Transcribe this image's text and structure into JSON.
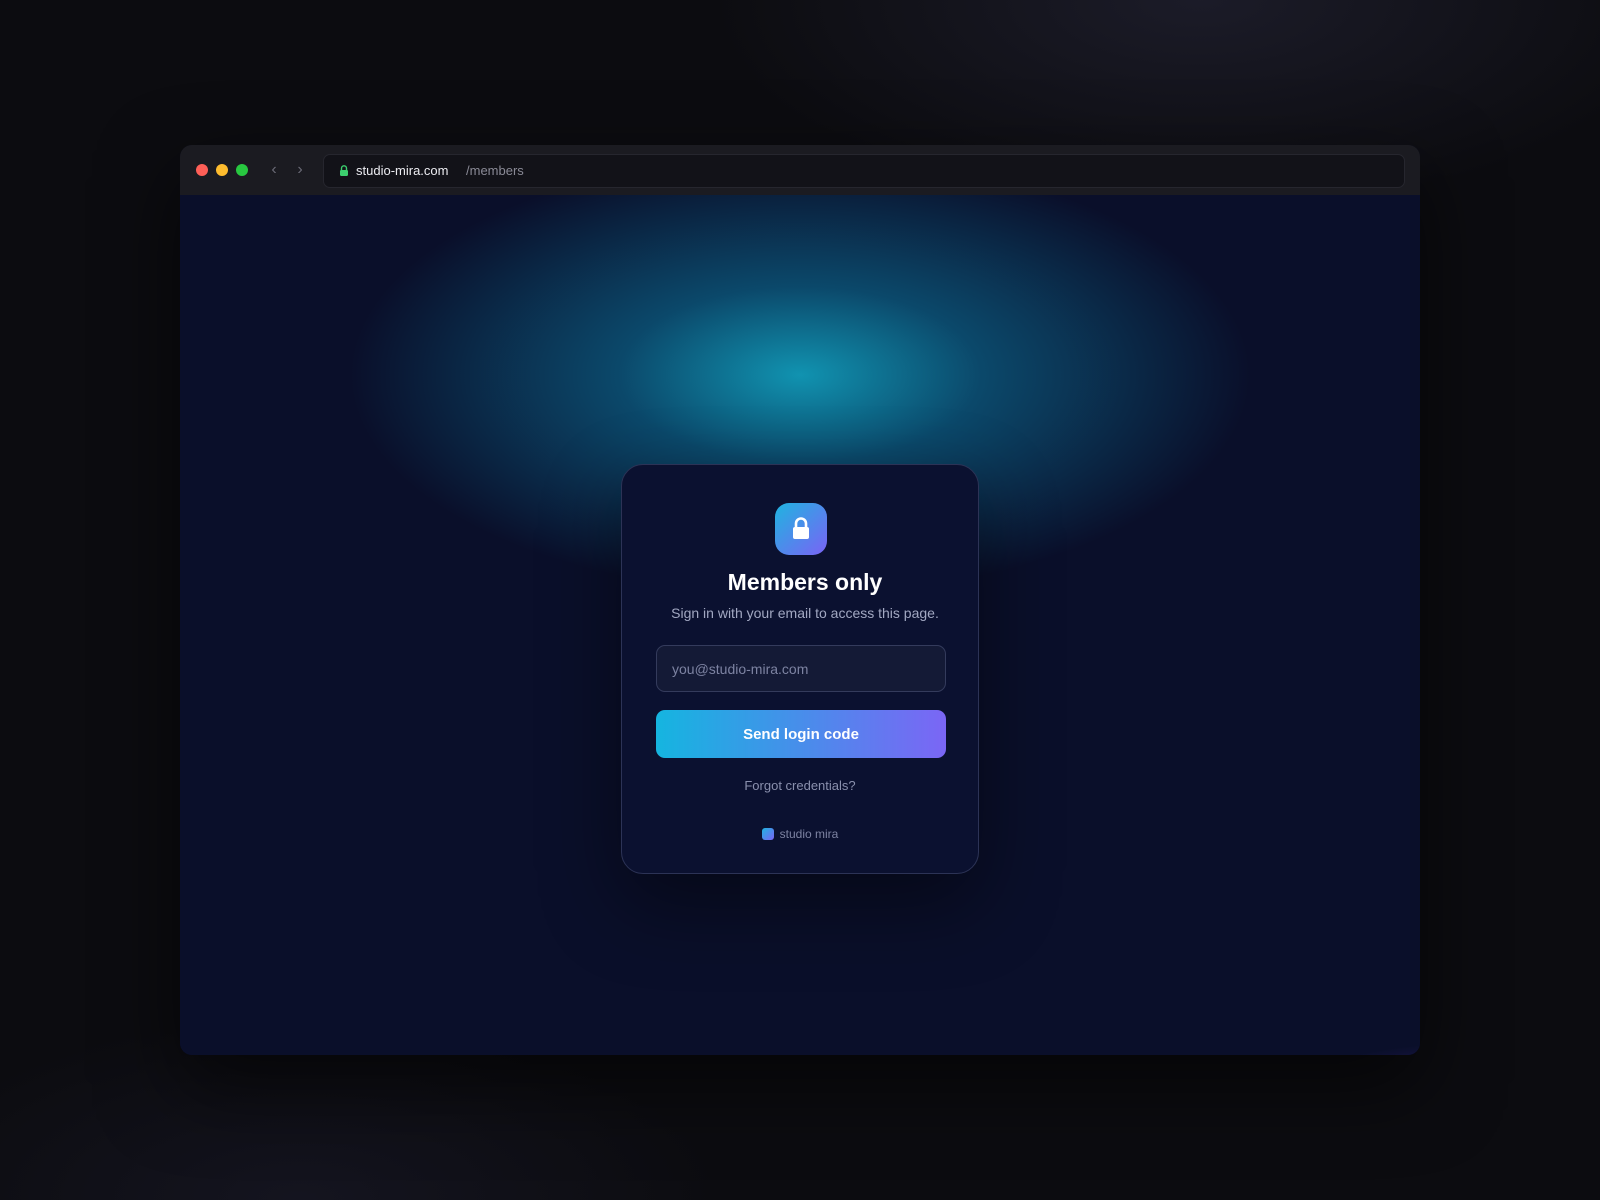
{
  "browser": {
    "domain": "studio-mira.com",
    "path": "/members",
    "nav_back_glyph": "‹",
    "nav_forward_glyph": "›",
    "secure_icon": "lock-icon"
  },
  "card": {
    "icon": "lock-icon",
    "title": "Members only",
    "subtitle": "Sign in with your email to access this page.",
    "email": {
      "value": "",
      "placeholder": "you@studio-mira.com"
    },
    "submit_label": "Send login code",
    "forgot_label": "Forgot credentials?",
    "brand_name": "studio mira"
  },
  "colors": {
    "accent_start": "#15b5e0",
    "accent_end": "#7b66f5",
    "page_bg": "#0a0f2a",
    "secure_lock": "#3ccf6e"
  }
}
